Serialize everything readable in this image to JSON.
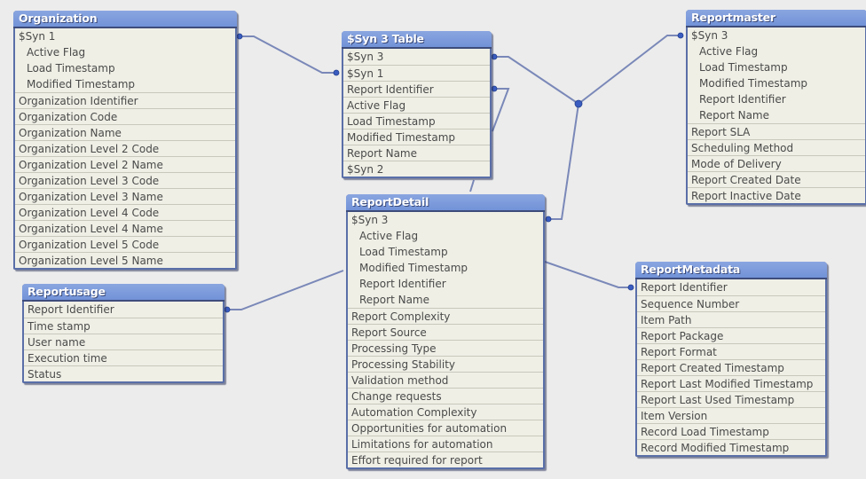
{
  "colors": {
    "background": "#ececec",
    "header": "#7b98dc",
    "link": "#7584b6",
    "node": "#3a5cc0"
  },
  "tables": {
    "organization": {
      "title": "Organization",
      "fields": [
        "$Syn 1",
        "Active Flag",
        "Load Timestamp",
        "Modified Timestamp",
        "Organization Identifier",
        "Organization Code",
        "Organization Name",
        "Organization Level 2 Code",
        "Organization Level 2 Name",
        "Organization Level 3 Code",
        "Organization Level 3 Name",
        "Organization Level 4 Code",
        "Organization Level 4 Name",
        "Organization Level 5 Code",
        "Organization Level 5 Name"
      ]
    },
    "syn3table": {
      "title": "$Syn 3 Table",
      "fields": [
        "$Syn 3",
        "$Syn 1",
        "Report Identifier",
        "Active Flag",
        "Load Timestamp",
        "Modified Timestamp",
        "Report Name",
        "$Syn 2"
      ]
    },
    "reportmaster": {
      "title": "Reportmaster",
      "fields": [
        "$Syn 3",
        "Active Flag",
        "Load Timestamp",
        "Modified Timestamp",
        "Report Identifier",
        "Report Name",
        "Report SLA",
        "Scheduling Method",
        "Mode of Delivery",
        "Report Created Date",
        "Report Inactive Date"
      ]
    },
    "reportdetail": {
      "title": "ReportDetail",
      "fields": [
        "$Syn 3",
        "Active Flag",
        "Load Timestamp",
        "Modified Timestamp",
        "Report Identifier",
        "Report Name",
        "Report Complexity",
        "Report Source",
        "Processing Type",
        "Processing Stability",
        "Validation method",
        "Change requests",
        "Automation Complexity",
        "Opportunities for automation",
        "Limitations for automation",
        "Effort required for report"
      ]
    },
    "reportusage": {
      "title": "Reportusage",
      "fields": [
        "Report Identifier",
        "Time stamp",
        "User name",
        "Execution time",
        "Status"
      ]
    },
    "reportmetadata": {
      "title": "ReportMetadata",
      "fields": [
        "Report Identifier",
        "Sequence Number",
        "Item Path",
        "Report Package",
        "Report Format",
        "Report Created Timestamp",
        "Report Last Modified Timestamp",
        "Report Last Used Timestamp",
        "Item Version",
        "Record Load Timestamp",
        "Record Modified Timestamp"
      ]
    }
  }
}
